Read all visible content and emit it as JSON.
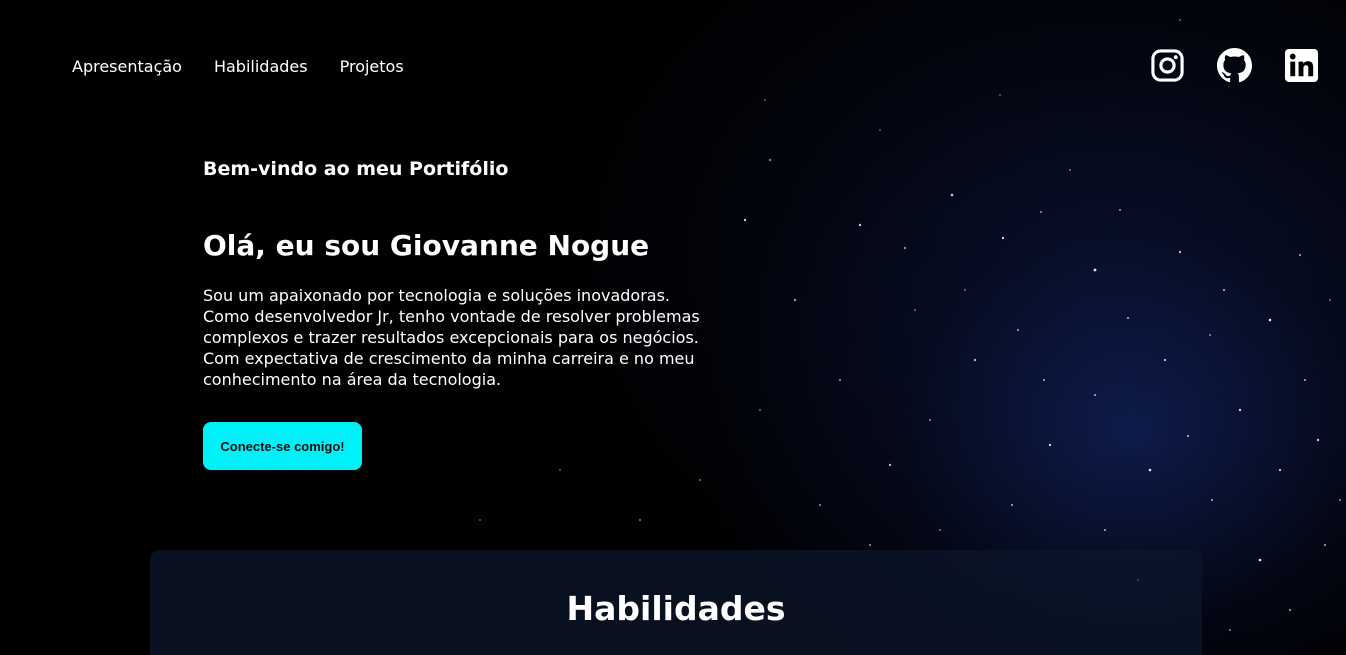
{
  "nav": {
    "items": [
      {
        "label": "Apresentação"
      },
      {
        "label": "Habilidades"
      },
      {
        "label": "Projetos"
      }
    ]
  },
  "social": {
    "icons": [
      "instagram-icon",
      "github-icon",
      "linkedin-icon"
    ]
  },
  "hero": {
    "welcome": "Bem-vindo ao meu Portifólio",
    "headline": "Olá, eu sou Giovanne Nogue",
    "description_lines": [
      "Sou um apaixonado por tecnologia e soluções inovadoras.",
      "Como desenvolvedor Jr, tenho vontade de resolver problemas",
      "complexos e trazer resultados excepcionais para os negócios.",
      "Com expectativa de crescimento da minha carreira e no meu",
      "conhecimento na área da tecnologia."
    ],
    "cta_label": "Conecte-se comigo!"
  },
  "skills": {
    "title": "Habilidades"
  },
  "colors": {
    "accent": "#00f0f8",
    "background": "#000000",
    "text": "#ffffff"
  }
}
